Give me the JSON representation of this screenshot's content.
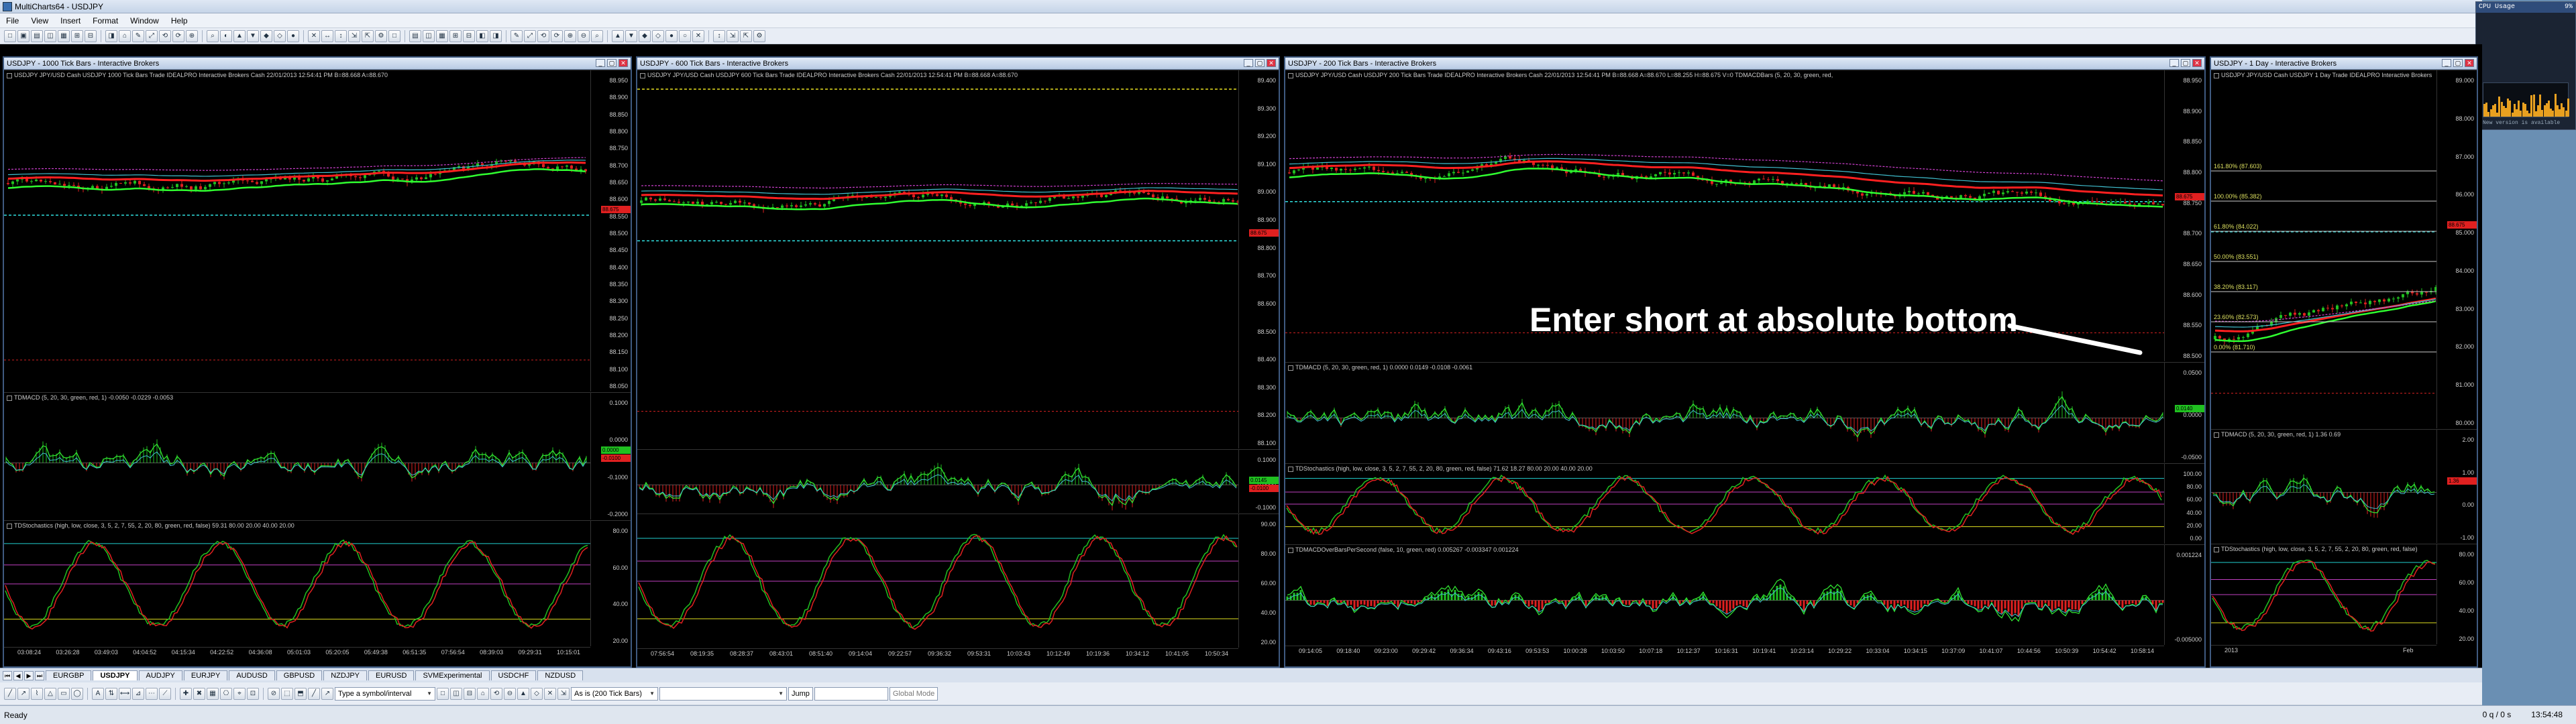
{
  "app": {
    "title": "MultiCharts64 - USDJPY"
  },
  "menu": [
    "File",
    "View",
    "Insert",
    "Format",
    "Window",
    "Help"
  ],
  "annotation": "Enter short at absolute bottom",
  "cpu_widget": {
    "title": "CPU Usage",
    "value": "9%",
    "footer": "New version is available"
  },
  "charts": [
    {
      "id": "w1",
      "title": "USDJPY - 1000 Tick Bars - Interactive Brokers",
      "info": "USDJPY  JPY/USD Cash USDJPY  1000 Tick Bars   Trade  IDEALPRO  Interactive Brokers  Cash   22/01/2013  12:54:41 PM  B=88.668  A=88.670",
      "price_ticks": [
        "88.950",
        "88.900",
        "88.850",
        "88.800",
        "88.750",
        "88.700",
        "88.650",
        "88.600",
        "88.550",
        "88.500",
        "88.450",
        "88.400",
        "88.350",
        "88.300",
        "88.250",
        "88.200",
        "88.150",
        "88.100",
        "88.050"
      ],
      "price_tags": [
        {
          "text": "88.675",
          "color": "#e02020"
        }
      ],
      "macd_label": "TDMACD (5, 20, 30, green, red, 1)  -0.0050  -0.0229  -0.0053",
      "macd_ticks": [
        "0.1000",
        "0.0000",
        "-0.1000",
        "-0.2000"
      ],
      "macd_tags": [
        {
          "text": "0.0000",
          "color": "#20c020"
        },
        {
          "text": "-0.0100",
          "color": "#e02020"
        }
      ],
      "stoch_label": "TDStochastics (high, low, close, 3, 5, 2, 7, 55, 2, 20, 80, green, red, false)  59.31   80.00  20.00  40.00  20.00",
      "stoch_ticks": [
        "80.00",
        "60.00",
        "40.00",
        "20.00"
      ],
      "time_ticks": [
        "03:08:24",
        "03:26:28",
        "03:49:03",
        "04:04:52",
        "04:15:34",
        "04:22:52",
        "04:36:08",
        "05:01:03",
        "05:20:05",
        "05:49:38",
        "06:51:35",
        "07:56:54",
        "08:39:03",
        "09:29:31",
        "10:15:01"
      ]
    },
    {
      "id": "w2",
      "title": "USDJPY - 600 Tick Bars - Interactive Brokers",
      "info": "USDJPY  JPY/USD Cash USDJPY  600 Tick Bars   Trade  IDEALPRO  Interactive Brokers  Cash   22/01/2013  12:54:41 PM  B=88.668  A=88.670",
      "price_ticks": [
        "89.400",
        "89.300",
        "89.200",
        "89.100",
        "89.000",
        "88.900",
        "88.800",
        "88.700",
        "88.600",
        "88.500",
        "88.400",
        "88.300",
        "88.200",
        "88.100"
      ],
      "price_tags": [
        {
          "text": "88.675",
          "color": "#e02020"
        }
      ],
      "macd_label": "",
      "macd_ticks": [
        "0.1000",
        "0.0000",
        "-0.1000"
      ],
      "macd_tags": [
        {
          "text": "0.0145",
          "color": "#20c020"
        },
        {
          "text": "-0.0100",
          "color": "#e02020"
        }
      ],
      "stoch_label": "",
      "stoch_ticks": [
        "90.00",
        "80.00",
        "60.00",
        "40.00",
        "20.00"
      ],
      "time_ticks": [
        "07:56:54",
        "08:19:35",
        "08:28:37",
        "08:43:01",
        "08:51:40",
        "09:14:04",
        "09:22:57",
        "09:36:32",
        "09:53:31",
        "10:03:43",
        "10:12:49",
        "10:19:36",
        "10:34:12",
        "10:41:05",
        "10:50:34"
      ]
    },
    {
      "id": "w3",
      "title": "USDJPY - 200 Tick Bars - Interactive Brokers",
      "info": "USDJPY  JPY/USD Cash USDJPY  200 Tick Bars   Trade  IDEALPRO  Interactive Brokers  Cash   22/01/2013  12:54:41 PM  B=88.668  A=88.670  L=88.255  H=88.675  V=0   TDMACDBars (5, 20, 30, green, red,",
      "price_ticks": [
        "88.950",
        "88.900",
        "88.850",
        "88.800",
        "88.750",
        "88.700",
        "88.650",
        "88.600",
        "88.550",
        "88.500"
      ],
      "price_tags": [
        {
          "text": "88.675",
          "color": "#e02020"
        }
      ],
      "macd_label": "TDMACD (5, 20, 30, green, red, 1)  0.0000  0.0149  -0.0108  -0.0061",
      "macd_ticks": [
        "0.0500",
        "0.0000",
        "-0.0500"
      ],
      "macd_tags": [
        {
          "text": "0.0140",
          "color": "#20c020"
        }
      ],
      "stoch_label": "TDStochastics (high, low, close, 3, 5, 2, 7, 55, 2, 20, 80, green, red, false)  71.62  18.27  80.00  20.00  40.00  20.00",
      "stoch_ticks": [
        "100.00",
        "80.00",
        "60.00",
        "40.00",
        "20.00",
        "0.00"
      ],
      "extra_label": "TDMACDOverBarsPerSecond (false, 10, green, red)  0.005267  -0.003347  0.001224",
      "extra_ticks": [
        "0.001224",
        "-0.005000"
      ],
      "time_ticks": [
        "09:14:05",
        "09:18:40",
        "09:23:00",
        "09:29:42",
        "09:36:34",
        "09:43:16",
        "09:53:53",
        "10:00:28",
        "10:03:50",
        "10:07:18",
        "10:12:37",
        "10:16:31",
        "10:19:41",
        "10:23:14",
        "10:29:22",
        "10:33:04",
        "10:34:15",
        "10:37:09",
        "10:41:07",
        "10:44:56",
        "10:50:39",
        "10:54:42",
        "10:58:14"
      ]
    },
    {
      "id": "w4",
      "title": "USDJPY - 1 Day - Interactive Brokers",
      "info": "USDJPY  JPY/USD Cash USDJPY  1 Day   Trade  IDEALPRO  Interactive Brokers",
      "price_ticks": [
        "89.000",
        "88.000",
        "87.000",
        "86.000",
        "85.000",
        "84.000",
        "83.000",
        "82.000",
        "81.000",
        "80.000"
      ],
      "price_tags": [
        {
          "text": "88.675",
          "color": "#e02020"
        }
      ],
      "fib_labels": [
        "161.80% (87.603)",
        "100.00% (85.382)",
        "61.80% (84.022)",
        "50.00% (83.551)",
        "38.20% (83.117)",
        "23.60% (82.573)",
        "0.00% (81.710)"
      ],
      "macd_label": "TDMACD (5, 20, 30, green, red, 1)  1.36  0.69",
      "macd_ticks": [
        "2.00",
        "1.00",
        "0.00",
        "-1.00"
      ],
      "macd_tags": [
        {
          "text": "1.36",
          "color": "#e02020"
        }
      ],
      "stoch_label": "TDStochastics (high, low, close, 3, 5, 2, 7, 55, 2, 20, 80, green, red, false)",
      "stoch_ticks": [
        "80.00",
        "60.00",
        "40.00",
        "20.00"
      ],
      "time_ticks": [
        "2013",
        "Feb"
      ]
    }
  ],
  "symbol_tabs": [
    "EURGBP",
    "USDJPY",
    "AUDJPY",
    "EURJPY",
    "AUDUSD",
    "GBPUSD",
    "NZDJPY",
    "EURUSD",
    "SVMExperimental",
    "USDCHF",
    "NZDUSD"
  ],
  "active_tab": "USDJPY",
  "bottom_toolbar": {
    "symbol_combo": "Type a symbol/interval",
    "resolution_combo": "As is (200 Tick Bars)",
    "jump": "Jump",
    "global_mode": "Global Mode"
  },
  "status": {
    "left": "Ready",
    "pair": "0 q / 0 s",
    "time": "13:54:48"
  },
  "colors": {
    "bull": "#20c020",
    "bear": "#e02020",
    "ma_red": "#ff2020",
    "ma_green": "#30ff30",
    "ma_cyan": "#40c0d0",
    "ma_magenta": "#d040d0",
    "dashed_cyan": "#30e0e0",
    "dashed_yellow": "#e8e020"
  }
}
